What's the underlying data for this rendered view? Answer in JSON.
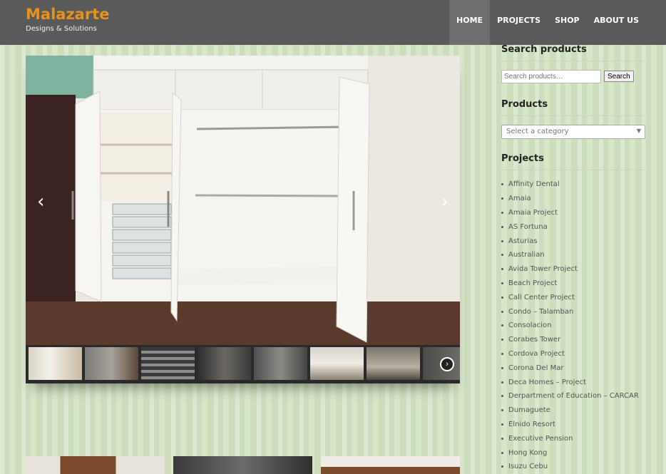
{
  "header": {
    "title": "Malazarte",
    "subtitle": "Designs & Solutions",
    "nav": [
      {
        "label": "HOME",
        "active": true
      },
      {
        "label": "PROJECTS",
        "active": false
      },
      {
        "label": "SHOP",
        "active": false
      },
      {
        "label": "ABOUT US",
        "active": false
      }
    ]
  },
  "slider": {
    "prev_icon": "chevron-left-icon",
    "next_icon": "chevron-right-icon",
    "thumb_count": 8
  },
  "sidebar": {
    "search_title": "Search products",
    "search_placeholder": "Search products…",
    "search_button": "Search",
    "products_title": "Products",
    "category_placeholder": "Select a category",
    "projects_title": "Projects",
    "projects": [
      "Affinity Dental",
      "Amaia",
      "Amaia Project",
      "AS Fortuna",
      "Asturias",
      "Australian",
      "Avida Tower Project",
      "Beach Project",
      "Call Center Project",
      "Condo – Talamban",
      "Consolacion",
      "Corabes Tower",
      "Cordova Project",
      "Corona Del Mar",
      "Deca Homes – Project",
      "Derpartment of Education – CARCAR",
      "Dumaguete",
      "Elnido Resort",
      "Executive Pension",
      "Hong Kong",
      "Isuzu Cebu"
    ]
  },
  "colors": {
    "brand": "#e8921e",
    "header_bg": "#5a5a5a"
  }
}
